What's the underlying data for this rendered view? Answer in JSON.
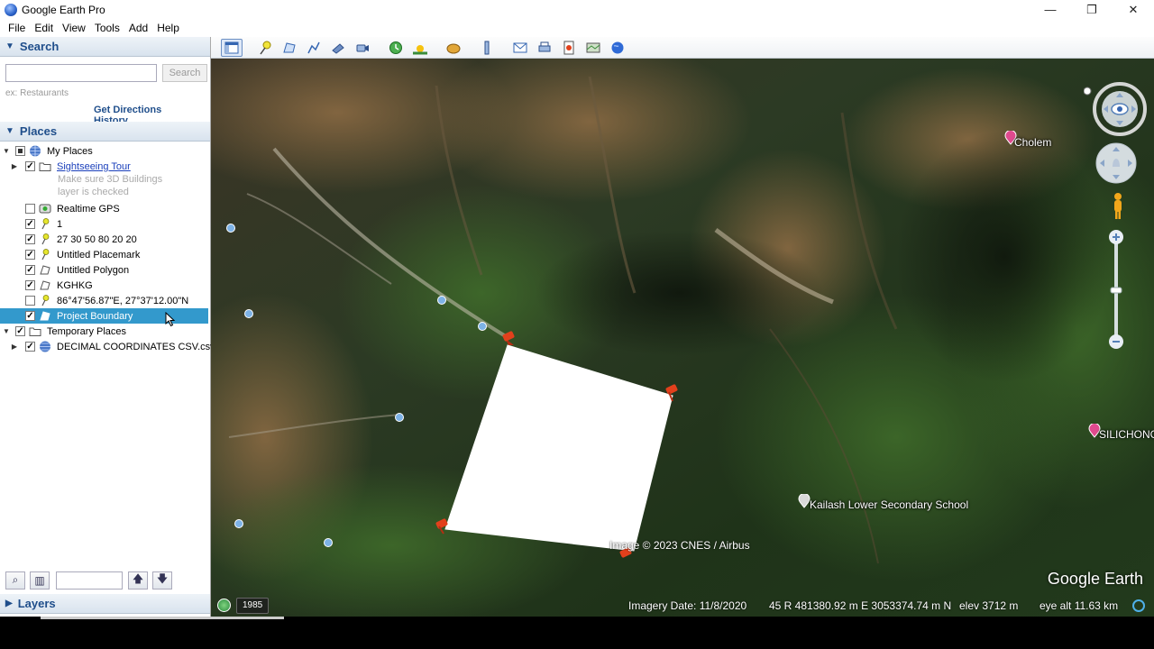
{
  "window": {
    "title": "Google Earth Pro",
    "controls": [
      "—",
      "❐",
      "✕"
    ]
  },
  "menu": [
    "File",
    "Edit",
    "View",
    "Tools",
    "Add",
    "Help"
  ],
  "search": {
    "header": "Search",
    "placeholder": "",
    "button": "Search",
    "hint": "ex: Restaurants",
    "get_directions": "Get Directions",
    "history": "History"
  },
  "places": {
    "header": "Places",
    "items": [
      {
        "label": "My Places",
        "checked": "partial",
        "expanded": true,
        "icon": "globe-icon"
      },
      {
        "label": "Sightseeing Tour",
        "checked": true,
        "icon": "folder-icon",
        "link": true
      },
      {
        "label": "Make sure 3D Buildings",
        "note": true
      },
      {
        "label": "layer is checked",
        "note": true
      },
      {
        "label": "Realtime GPS",
        "checked": false,
        "icon": "gps-icon"
      },
      {
        "label": "1",
        "checked": true,
        "icon": "pushpin-icon"
      },
      {
        "label": "27 30 50 80 20 20",
        "checked": true,
        "icon": "pushpin-icon"
      },
      {
        "label": "Untitled Placemark",
        "checked": true,
        "icon": "pushpin-icon"
      },
      {
        "label": "Untitled Polygon",
        "checked": true,
        "icon": "polygon-icon"
      },
      {
        "label": "KGHKG",
        "checked": true,
        "icon": "polygon-icon"
      },
      {
        "label": "86°47'56.87\"E, 27°37'12.00\"N",
        "checked": false,
        "icon": "pushpin-icon"
      },
      {
        "label": "Project Boundary",
        "checked": true,
        "icon": "polygon-icon",
        "selected": true
      },
      {
        "label": "Temporary Places",
        "checked": true,
        "expanded": true,
        "icon": "folder-icon"
      },
      {
        "label": "DECIMAL COORDINATES CSV.csv",
        "checked": true,
        "icon": "globe-icon"
      }
    ]
  },
  "layers": {
    "header": "Layers"
  },
  "map": {
    "labels": {
      "cholem": "Cholem",
      "silichong": "SILICHONG",
      "school": "Kailash Lower Secondary School"
    },
    "copyright": "Image © 2023 CNES / Airbus",
    "logo": "Google Earth",
    "year": "1985",
    "status": {
      "imagery_date": "Imagery Date: 11/8/2020",
      "coords": "45 R 481380.92 m E 3053374.74 m N",
      "elev": "elev  3712 m",
      "eye_alt": "eye alt  11.63 km"
    }
  },
  "colors": {
    "selection": "#3399cc",
    "header_text": "#1f4e8b",
    "pin": "#e2401c",
    "polygon_fill": "#ffffff"
  }
}
